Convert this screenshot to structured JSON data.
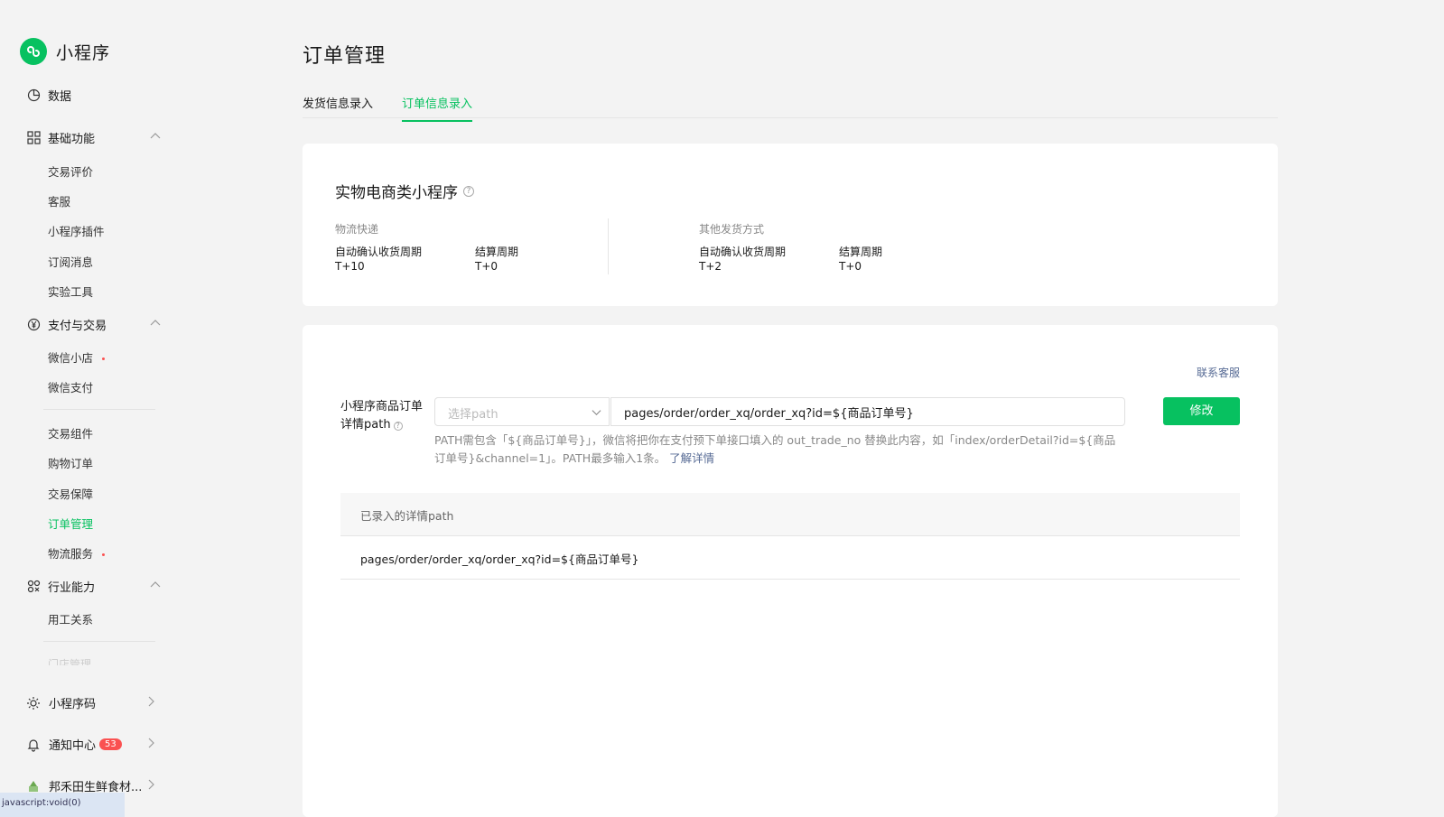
{
  "brand": {
    "name": "小程序"
  },
  "sidebar": {
    "data_label": "数据",
    "groups": [
      {
        "label": "基础功能",
        "items": [
          "交易评价",
          "客服",
          "小程序插件",
          "订阅消息",
          "实验工具"
        ]
      },
      {
        "label": "支付与交易",
        "items_a": [
          "微信小店",
          "微信支付"
        ],
        "items_b": [
          "交易组件",
          "购物订单",
          "交易保障",
          "订单管理",
          "物流服务"
        ]
      },
      {
        "label": "行业能力",
        "items": [
          "用工关系"
        ]
      }
    ],
    "faded_item": "门店管理",
    "bottom": {
      "qrcode": "小程序码",
      "notify": "通知中心",
      "notify_count": "53",
      "account": "邦禾田生鲜食材..."
    },
    "status_strip": "javascript:void(0)"
  },
  "page": {
    "title": "订单管理"
  },
  "tabs": [
    "发货信息录入",
    "订单信息录入"
  ],
  "card1": {
    "title": "实物电商类小程序",
    "logistics": {
      "label": "物流快递",
      "k1": "自动确认收货周期",
      "v1": "T+10",
      "k2": "结算周期",
      "v2": "T+0"
    },
    "other": {
      "label": "其他发货方式",
      "k1": "自动确认收货周期",
      "v1": "T+2",
      "k2": "结算周期",
      "v2": "T+0"
    }
  },
  "card2": {
    "contact": "联系客服",
    "form_label_line1": "小程序商品订单",
    "form_label_line2": "详情path",
    "select_placeholder": "选择path",
    "path_value": "pages/order/order_xq/order_xq?id=${商品订单号}",
    "modify_btn": "修改",
    "hint": "PATH需包含「${商品订单号}」，微信将把你在支付预下单接口填入的 out_trade_no 替换此内容，如「index/orderDetail?id=${商品订单号}&channel=1」。PATH最多输入1条。",
    "hint_link": "了解详情",
    "table_header": "已录入的详情path",
    "table_rows": [
      "pages/order/order_xq/order_xq?id=${商品订单号}"
    ]
  },
  "colors": {
    "accent": "#07c160",
    "link": "#576b95",
    "badge": "#fa5151"
  }
}
